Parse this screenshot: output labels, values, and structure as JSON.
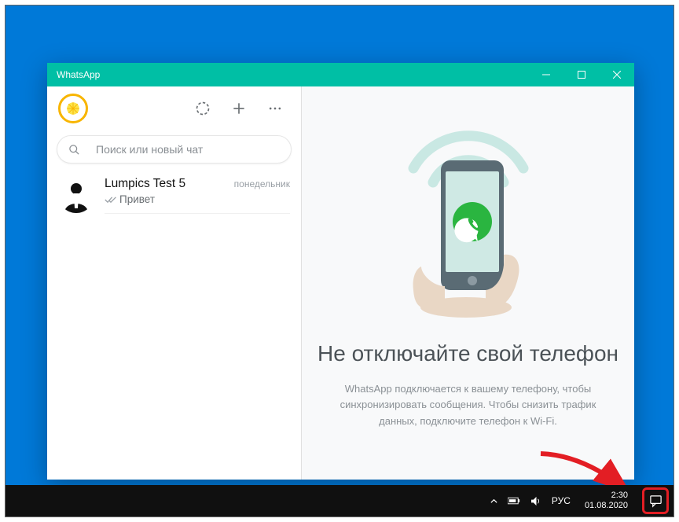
{
  "window": {
    "title": "WhatsApp"
  },
  "header": {
    "status_icon": "status-circle",
    "new_chat_icon": "plus",
    "menu_icon": "dots"
  },
  "search": {
    "placeholder": "Поиск или новый чат"
  },
  "chat": {
    "name": "Lumpics Test 5",
    "day": "понедельник",
    "preview": "Привет"
  },
  "main": {
    "heading": "Не отключайте свой телефон",
    "desc": "WhatsApp подключается к вашему телефону, чтобы синхронизировать сообщения. Чтобы снизить трафик данных, подключите телефон к Wi-Fi."
  },
  "taskbar": {
    "lang": "РУС",
    "time": "2:30",
    "date": "01.08.2020"
  },
  "colors": {
    "accent": "#00bfa5",
    "desktop": "#0079d8"
  }
}
